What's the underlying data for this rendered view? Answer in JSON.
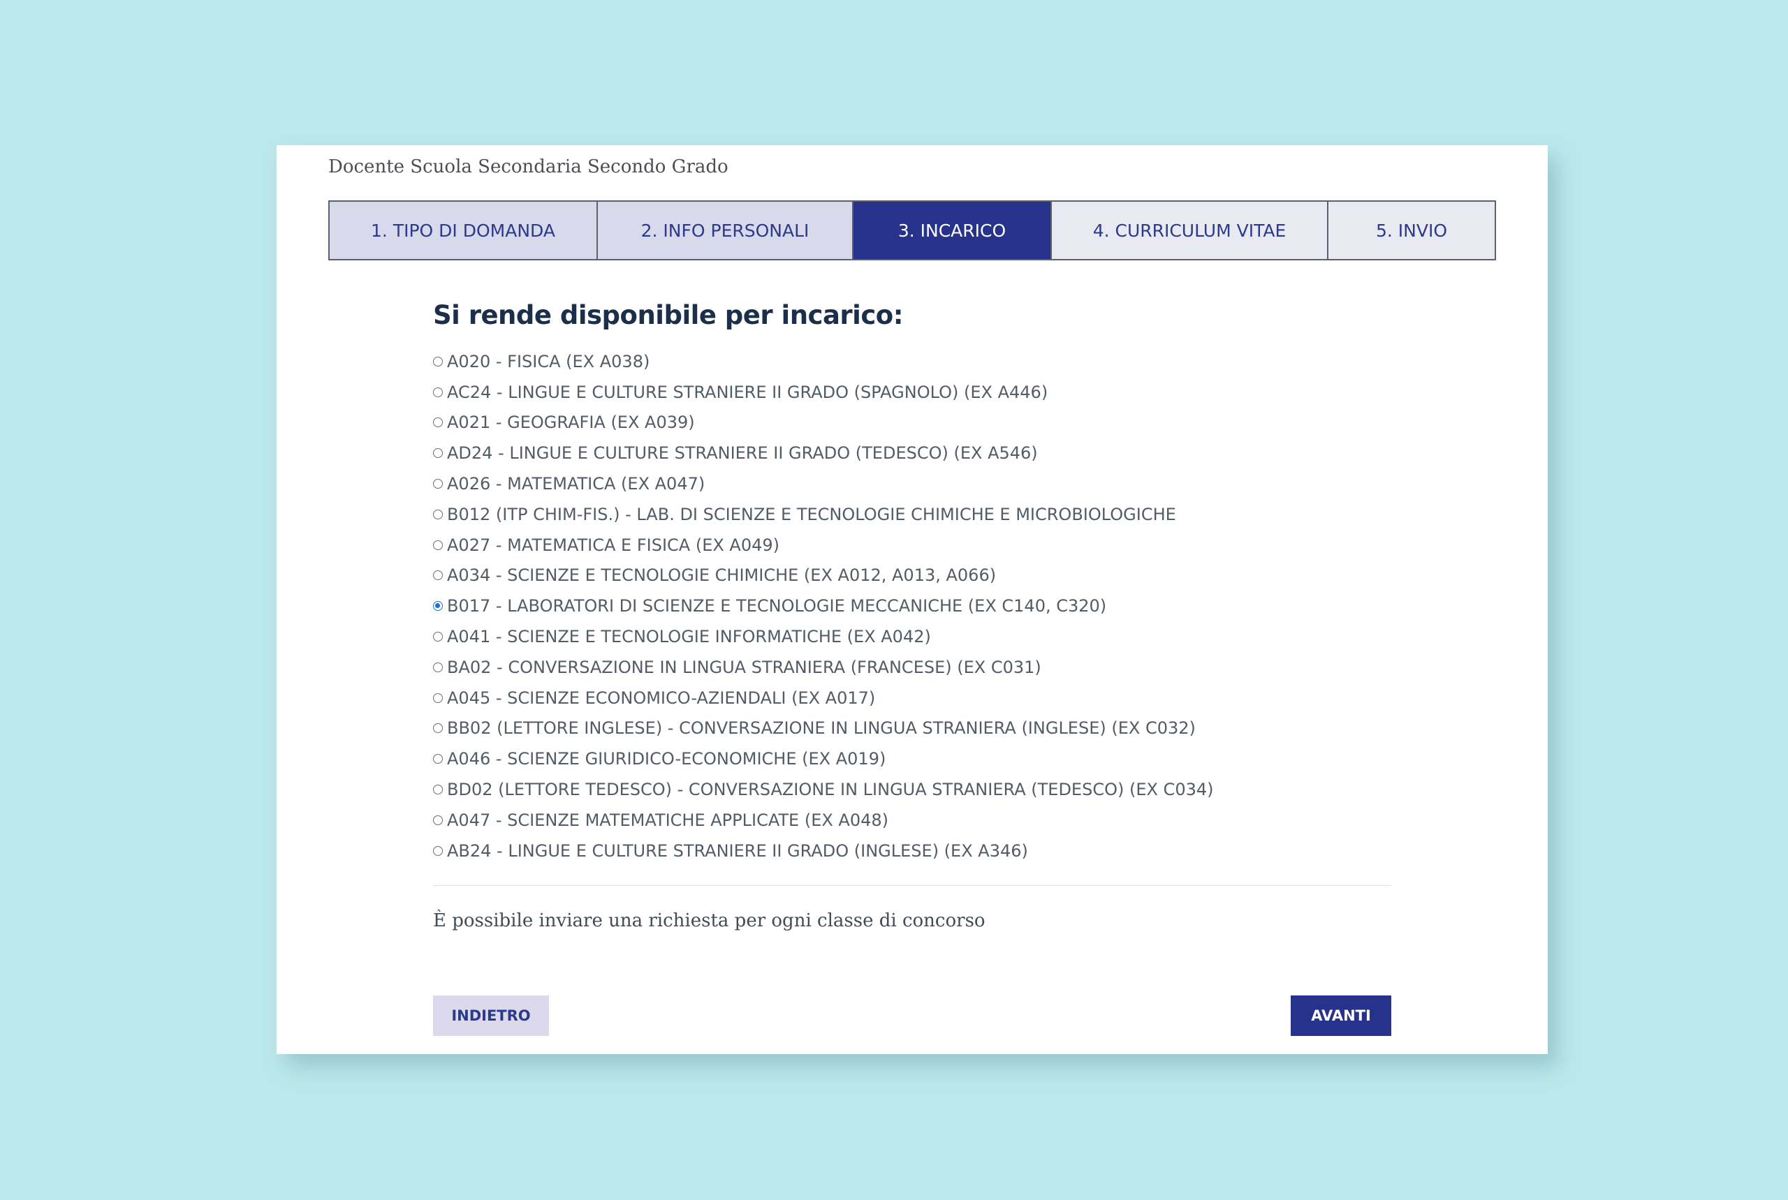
{
  "page": {
    "title": "Docente Scuola Secondaria Secondo Grado"
  },
  "steps": [
    {
      "label": "1. TIPO DI DOMANDA",
      "state": "done"
    },
    {
      "label": "2. INFO PERSONALI",
      "state": "done"
    },
    {
      "label": "3. INCARICO",
      "state": "active"
    },
    {
      "label": "4. CURRICULUM VITAE",
      "state": "todo"
    },
    {
      "label": "5. INVIO",
      "state": "todo"
    }
  ],
  "form": {
    "heading": "Si rende disponibile per incarico:",
    "selected_index": 8,
    "options": [
      "A020 - FISICA (EX A038)",
      "AC24 - LINGUE E CULTURE STRANIERE II GRADO (SPAGNOLO) (EX A446)",
      "A021 - GEOGRAFIA (EX A039)",
      "AD24 - LINGUE E CULTURE STRANIERE II GRADO (TEDESCO) (EX A546)",
      "A026 - MATEMATICA (EX A047)",
      "B012 (ITP CHIM-FIS.) - LAB. DI SCIENZE E TECNOLOGIE CHIMICHE E MICROBIOLOGICHE",
      "A027 - MATEMATICA E FISICA (EX A049)",
      "A034 - SCIENZE E TECNOLOGIE CHIMICHE (EX A012, A013, A066)",
      "B017 - LABORATORI DI SCIENZE E TECNOLOGIE MECCANICHE (EX C140, C320)",
      "A041 - SCIENZE E TECNOLOGIE INFORMATICHE (EX A042)",
      "BA02 - CONVERSAZIONE IN LINGUA STRANIERA (FRANCESE) (EX C031)",
      "A045 - SCIENZE ECONOMICO-AZIENDALI (EX A017)",
      "BB02 (LETTORE INGLESE) - CONVERSAZIONE IN LINGUA STRANIERA (INGLESE) (EX C032)",
      "A046 - SCIENZE GIURIDICO-ECONOMICHE (EX A019)",
      "BD02 (LETTORE TEDESCO) - CONVERSAZIONE IN LINGUA STRANIERA (TEDESCO) (EX C034)",
      "A047 - SCIENZE MATEMATICHE APPLICATE (EX A048)",
      "AB24 - LINGUE E CULTURE STRANIERE II GRADO (INGLESE) (EX A346)"
    ],
    "note": "È possibile inviare una richiesta per ogni classe di concorso"
  },
  "buttons": {
    "back_label": "INDIETRO",
    "next_label": "AVANTI"
  },
  "colors": {
    "background": "#bde8eb",
    "primary": "#26328c",
    "step_done": "#d8d9ea",
    "step_todo": "#e9eaf1",
    "radio_checked": "#1a6fe0"
  }
}
